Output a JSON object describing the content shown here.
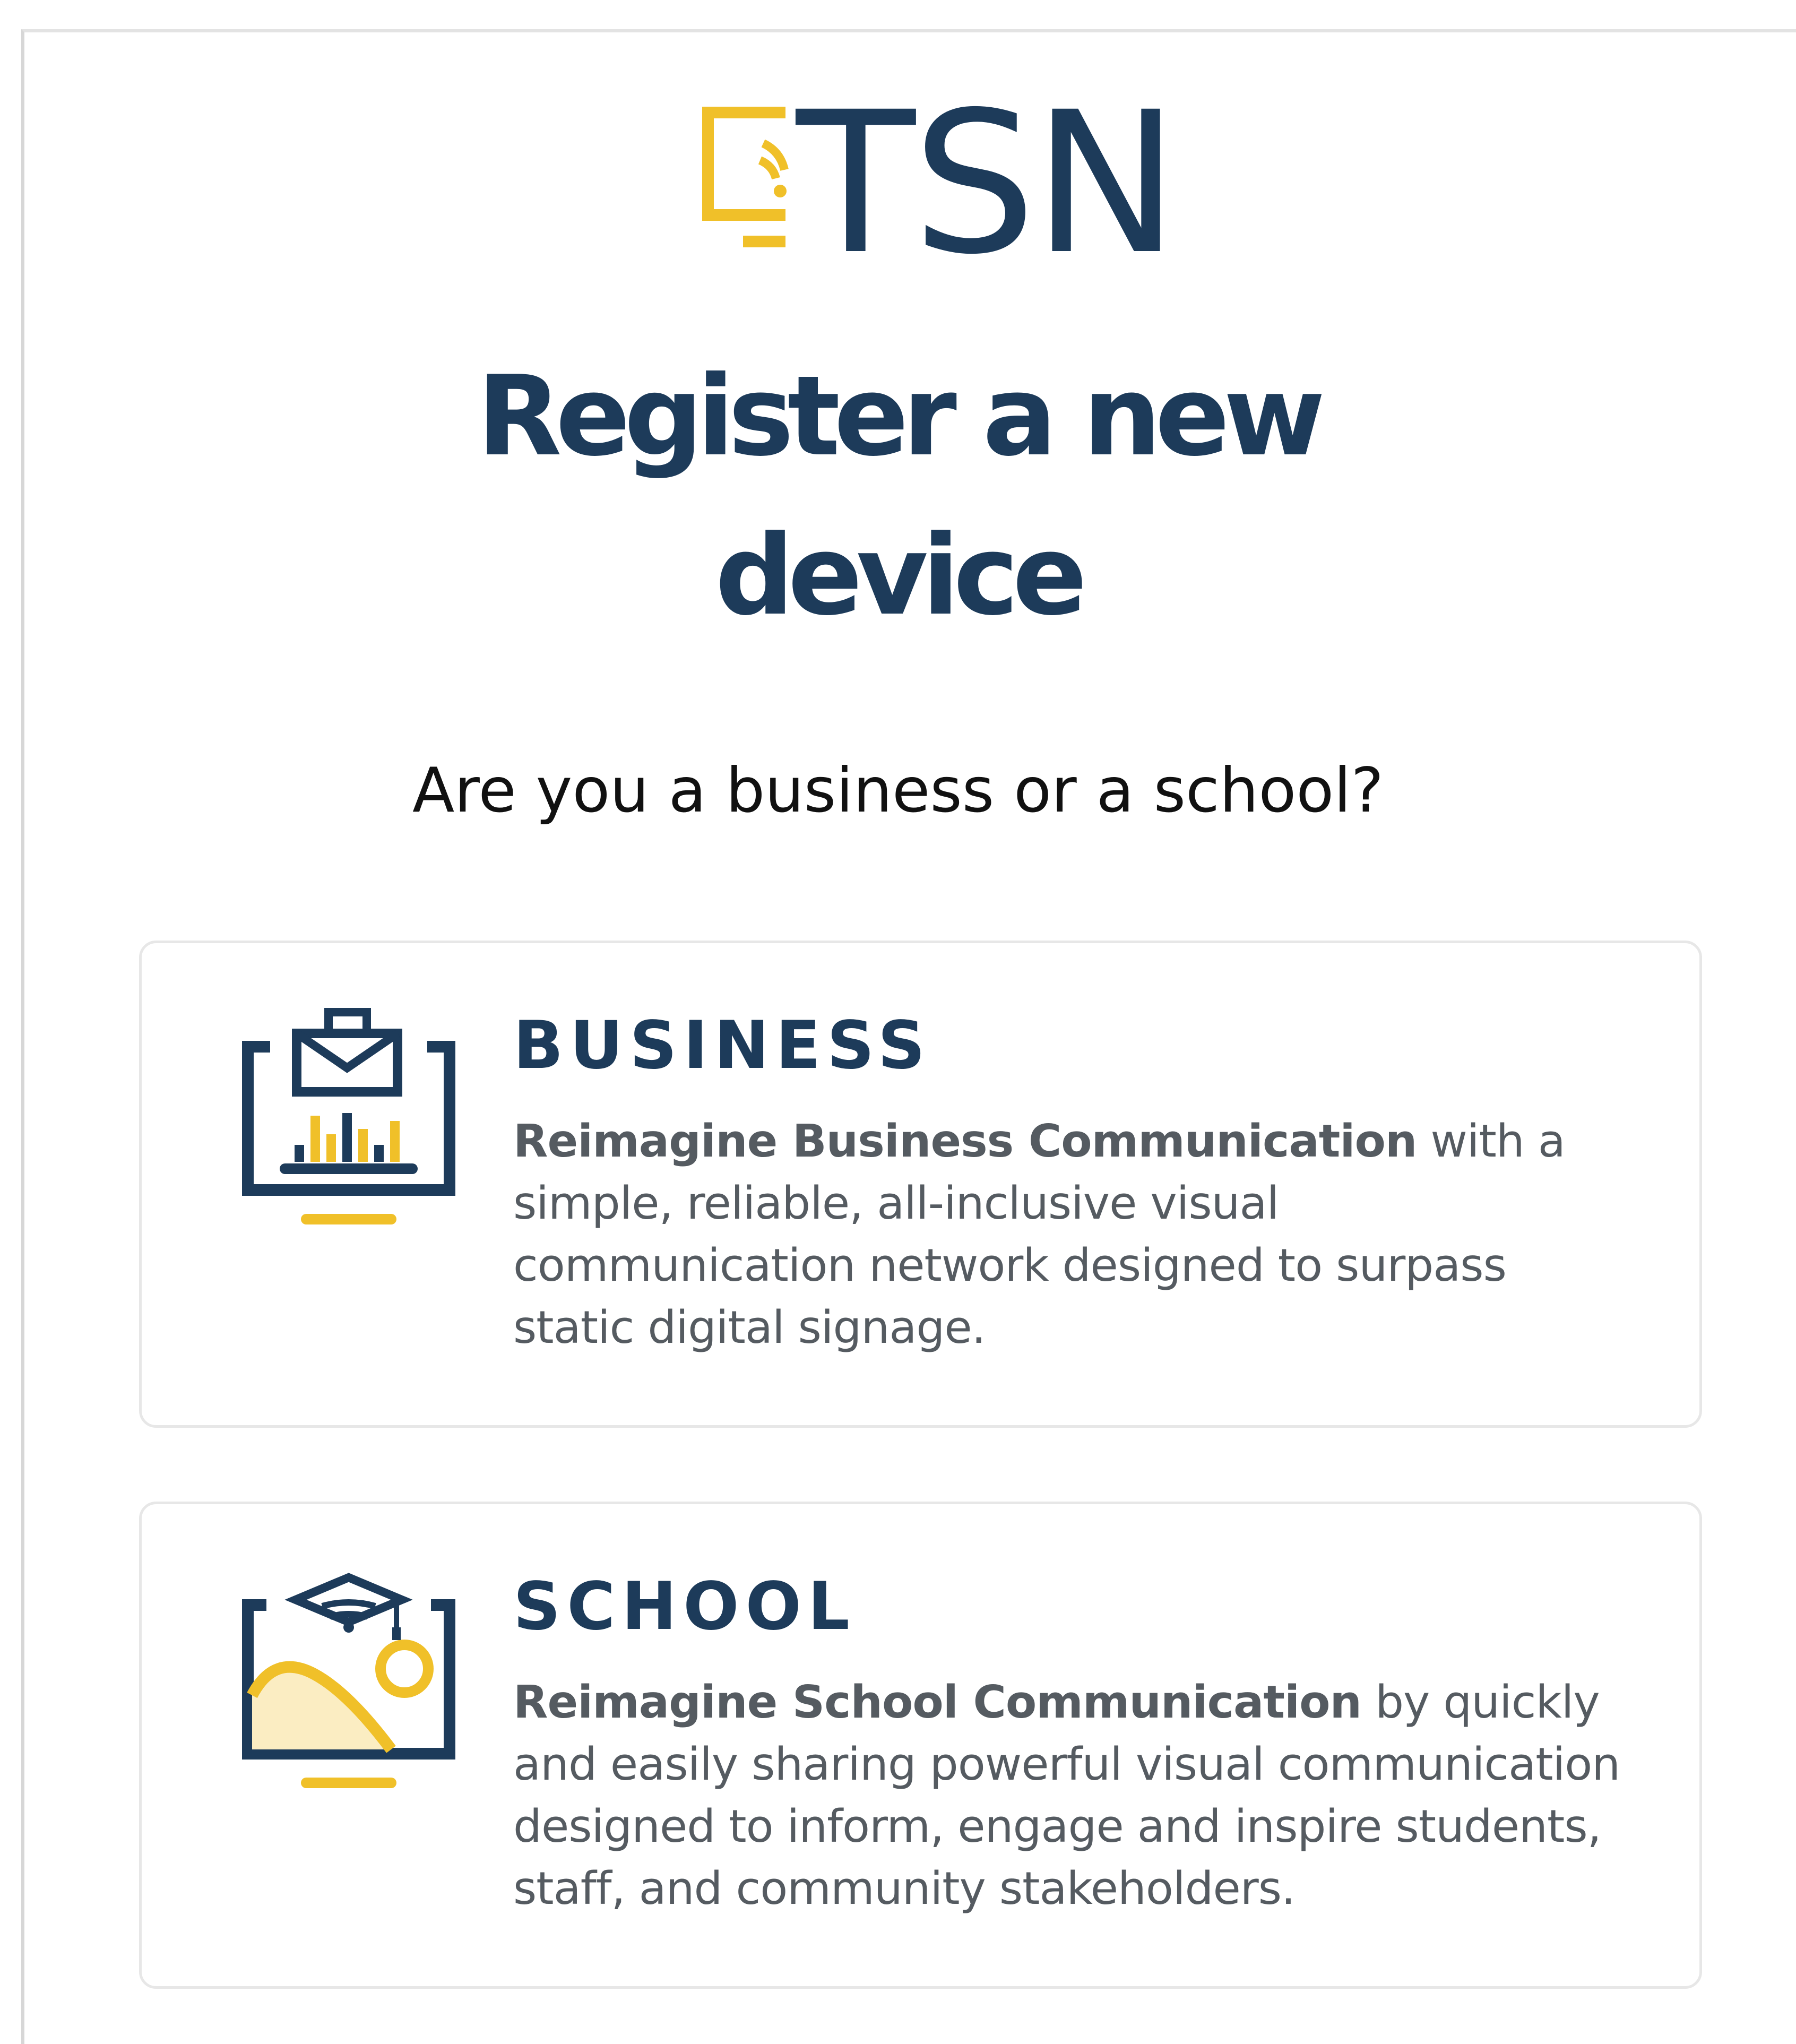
{
  "logo": {
    "text": "TSN",
    "icon": "monitor-wifi-icon"
  },
  "title": {
    "line1": "Register a new",
    "line2": "device"
  },
  "question": "Are you a business or a school?",
  "options": [
    {
      "heading": "BUSINESS",
      "lead": "Reimagine Business Communication",
      "rest": " with a simple, reliable, all-inclusive visual communication network designed to surpass static digital signage.",
      "icon": "business-monitor-icon"
    },
    {
      "heading": "SCHOOL",
      "lead": "Reimagine School Communication",
      "rest": " by quickly and easily sharing powerful visual communication designed to inform, engage and inspire students, staff, and community stakeholders.",
      "icon": "school-monitor-icon"
    }
  ],
  "colors": {
    "navy": "#1d3b5a",
    "gold": "#f0c029",
    "light_gold": "#fbedc2",
    "text_gray": "#555b61"
  }
}
